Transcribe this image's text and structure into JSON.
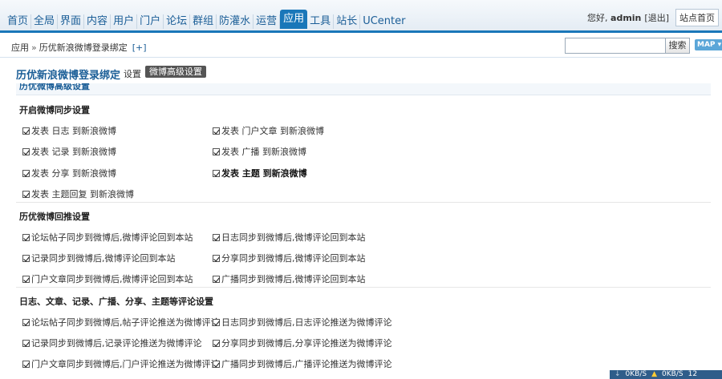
{
  "nav": [
    "首页",
    "全局",
    "界面",
    "内容",
    "用户",
    "门户",
    "论坛",
    "群组",
    "防灌水",
    "运营",
    "应用",
    "工具",
    "站长",
    "UCenter"
  ],
  "nav_active_index": 10,
  "user": {
    "greeting_prefix": "您好,",
    "username": "admin",
    "logout": "[退出]",
    "home": "站点首页"
  },
  "breadcrumb": {
    "root": "应用",
    "sep": "»",
    "current": "历优新浪微博登录绑定",
    "plus": "[+]"
  },
  "search": {
    "value": "",
    "button": "搜索"
  },
  "map_label": "MAP ▾",
  "plugin": {
    "title": "历优新浪微博登录绑定",
    "tab_settings": "设置",
    "tab_advanced": "微博高级设置"
  },
  "cutoff_header": "历优微博高级设置",
  "sections": [
    {
      "title": "开启微博同步设置",
      "options": [
        {
          "label": "发表 日志 到新浪微博",
          "checked": true
        },
        {
          "label": "发表 门户文章 到新浪微博",
          "checked": true
        },
        {
          "label": "发表 记录 到新浪微博",
          "checked": true
        },
        {
          "label": "发表 广播 到新浪微博",
          "checked": true
        },
        {
          "label": "发表 分享 到新浪微博",
          "checked": true
        },
        {
          "label": "发表 主题 到新浪微博",
          "checked": true,
          "bold": true
        },
        {
          "label": "发表 主题回复 到新浪微博",
          "checked": true
        }
      ]
    },
    {
      "title": "历优微博回推设置",
      "options": [
        {
          "label": "论坛帖子同步到微博后,微博评论回到本站",
          "checked": true
        },
        {
          "label": "日志同步到微博后,微博评论回到本站",
          "checked": true
        },
        {
          "label": "记录同步到微博后,微博评论回到本站",
          "checked": true
        },
        {
          "label": "分享同步到微博后,微博评论回到本站",
          "checked": true
        },
        {
          "label": "门户文章同步到微博后,微博评论回到本站",
          "checked": true
        },
        {
          "label": "广播同步到微博后,微博评论回到本站",
          "checked": true
        }
      ]
    },
    {
      "title": "日志、文章、记录、广播、分享、主题等评论设置",
      "options": [
        {
          "label": "论坛帖子同步到微博后,帖子评论推送为微博评论",
          "checked": true
        },
        {
          "label": "日志同步到微博后,日志评论推送为微博评论",
          "checked": true
        },
        {
          "label": "记录同步到微博后,记录评论推送为微博评论",
          "checked": true
        },
        {
          "label": "分享同步到微博后,分享评论推送为微博评论",
          "checked": true
        },
        {
          "label": "门户文章同步到微博后,门户评论推送为微博评论",
          "checked": true
        },
        {
          "label": "广播同步到微博后,广播评论推送为微博评论",
          "checked": true
        }
      ]
    }
  ],
  "taskbar": {
    "speed1": "0KB/S",
    "speed2": "0KB/S",
    "clock": "12"
  }
}
